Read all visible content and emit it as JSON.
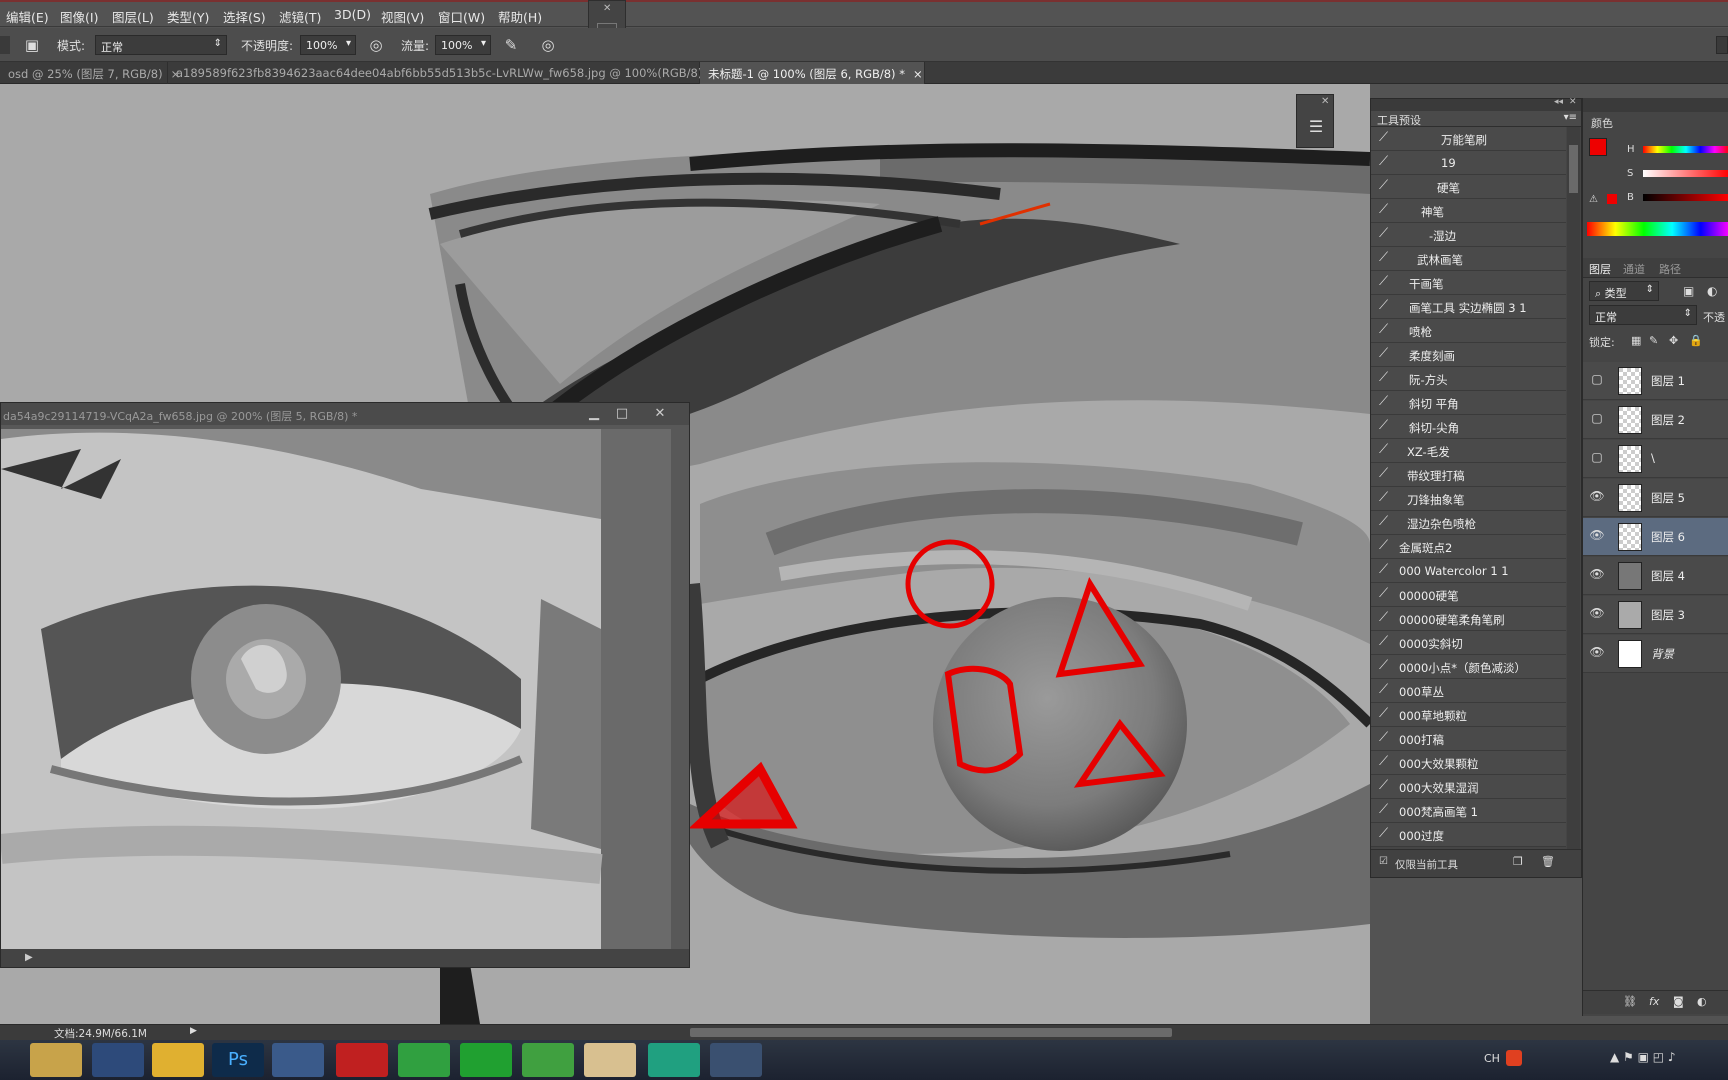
{
  "menu": [
    "编辑(E)",
    "图像(I)",
    "图层(L)",
    "类型(Y)",
    "选择(S)",
    "滤镜(T)",
    "3D(D)",
    "视图(V)",
    "窗口(W)",
    "帮助(H)"
  ],
  "options": {
    "mode_label": "模式:",
    "mode_value": "正常",
    "opacity_label": "不透明度:",
    "opacity_value": "100%",
    "flow_label": "流量:",
    "flow_value": "100%"
  },
  "tabs": [
    {
      "label": "osd @ 25% (图层 7, RGB/8)"
    },
    {
      "label": "a189589f623fb8394623aac64dee04abf6bb55d513b5c-LvRLWw_fw658.jpg @ 100%(RGB/8)"
    },
    {
      "label": "未标题-1 @ 100% (图层 6, RGB/8) *"
    }
  ],
  "reference_window": {
    "title": "da54a9c29114719-VCqA2a_fw658.jpg @ 200% (图层 5, RGB/8) *"
  },
  "presets": {
    "title": "工具预设",
    "items": [
      "万能笔刷",
      "19",
      "硬笔",
      "神笔",
      "-湿边",
      "武林画笔",
      "干画笔",
      "画笔工具 实边椭圆 3 1",
      "喷枪",
      "柔度刻画",
      "阮-方头",
      "斜切 平角",
      "斜切-尖角",
      "XZ-毛发",
      "带纹理打稿",
      "刀锋抽象笔",
      "湿边杂色喷枪",
      "金属斑点2",
      "000 Watercolor 1 1",
      "00000硬笔",
      "00000硬笔柔角笔刷",
      "0000实斜切",
      "0000小点*（颜色减淡）",
      "000草丛",
      "000草地颗粒",
      "000打稿",
      "000大效果颗粒",
      "000大效果湿润",
      "000梵高画笔 1",
      "000过度"
    ],
    "footer": "仅限当前工具"
  },
  "color_panel": {
    "title": "颜色",
    "h": "H",
    "s": "S",
    "b": "B",
    "fg_color": "#ee0000"
  },
  "layers_panel": {
    "tabs": [
      "图层",
      "通道",
      "路径"
    ],
    "filter": "类型",
    "blend": "正常",
    "opacity_short": "不透",
    "lock_label": "锁定:",
    "layers": [
      {
        "name": "图层 1",
        "visible": false
      },
      {
        "name": "图层 2",
        "visible": false
      },
      {
        "name": "\\",
        "visible": false
      },
      {
        "name": "图层 5",
        "visible": true
      },
      {
        "name": "图层 6",
        "visible": true,
        "selected": true
      },
      {
        "name": "图层 4",
        "visible": true
      },
      {
        "name": "图层 3",
        "visible": true
      },
      {
        "name": "背景",
        "visible": true
      }
    ]
  },
  "status": {
    "doc": "文档:24.9M/66.1M"
  },
  "tray": {
    "lang": "CH"
  }
}
